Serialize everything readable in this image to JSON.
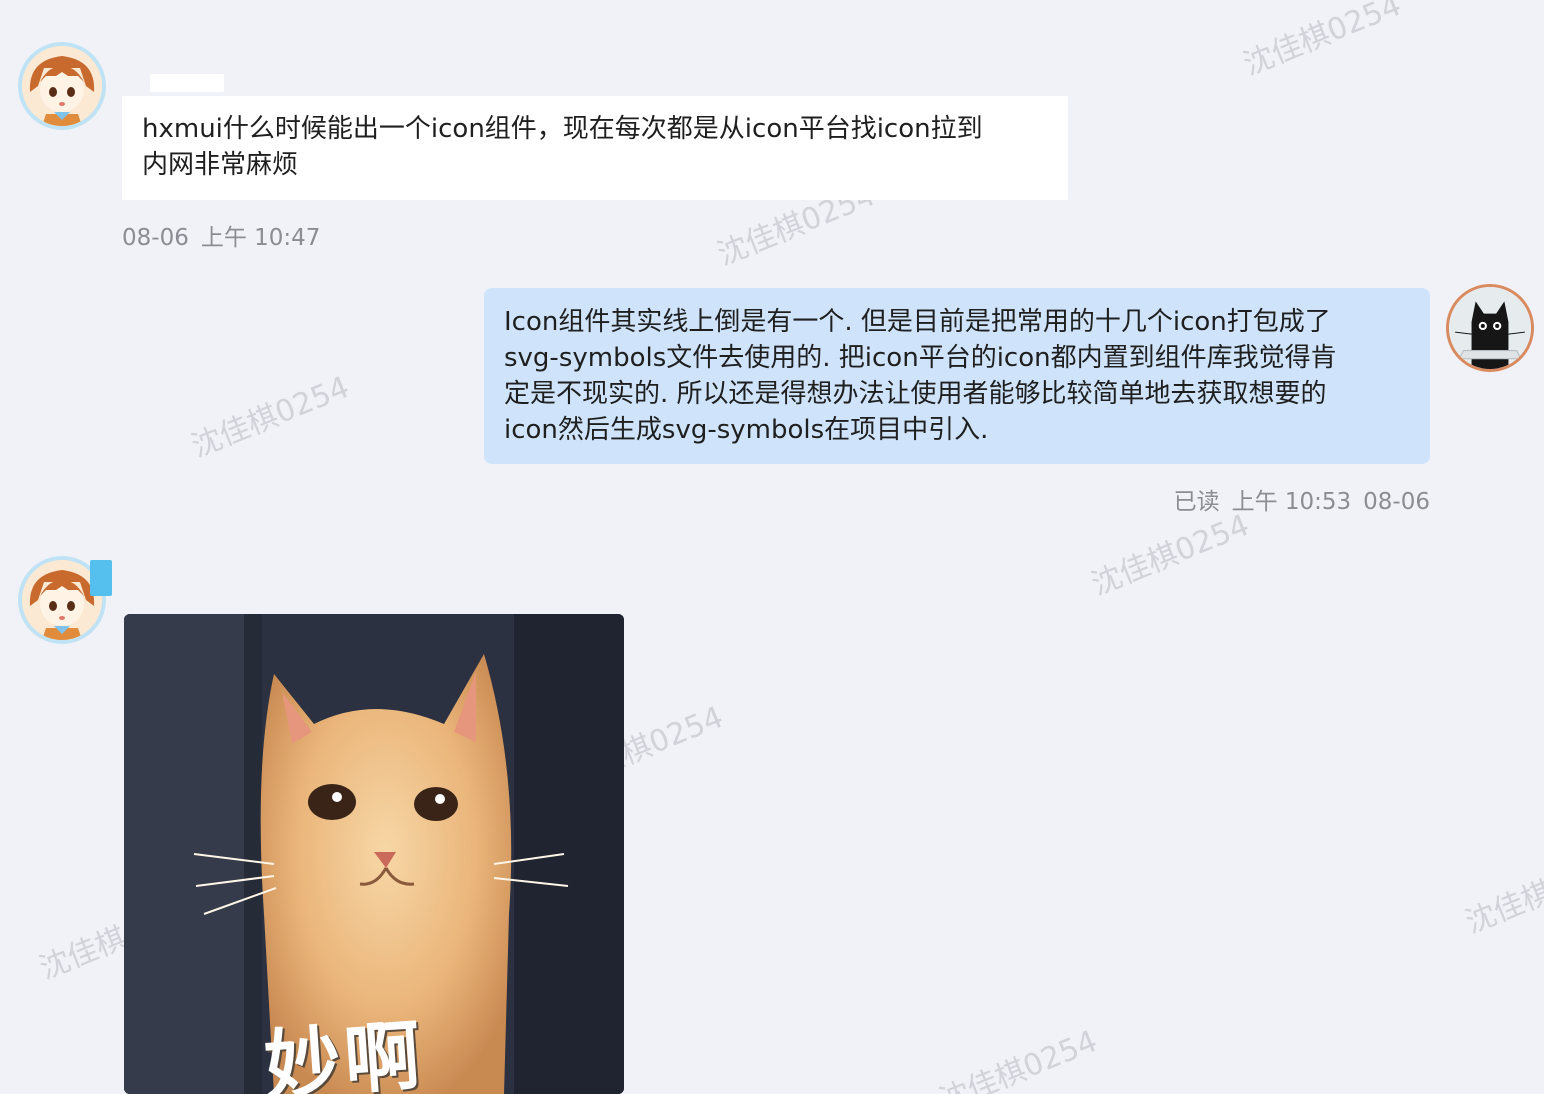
{
  "messages": [
    {
      "text": "hxmui什么时候能出一个icon组件，现在每次都是从icon平台找icon拉到\n内网非常麻烦",
      "date": "08-06",
      "time": "上午 10:47"
    },
    {
      "text": "Icon组件其实线上倒是有一个. 但是目前是把常用的十几个icon打包成了\nsvg-symbols文件去使用的. 把icon平台的icon都内置到组件库我觉得肯\n定是不现实的. 所以还是得想办法让使用者能够比较简单地去获取想要的\nicon然后生成svg-symbols在项目中引入.",
      "read_status": "已读",
      "time": "上午 10:53",
      "date": "08-06"
    },
    {
      "sticker_icon": "cat-sticker",
      "sticker_caption": "妙啊"
    }
  ],
  "watermark": "沈佳棋0254",
  "icons": {
    "incoming_avatar": "anime-girl-avatar-icon",
    "outgoing_avatar": "black-cat-avatar-icon"
  },
  "colors": {
    "background": "#f1f2f7",
    "incoming_bubble": "#ffffff",
    "outgoing_bubble": "#cfe4fb",
    "meta_text": "#8a8d93"
  }
}
